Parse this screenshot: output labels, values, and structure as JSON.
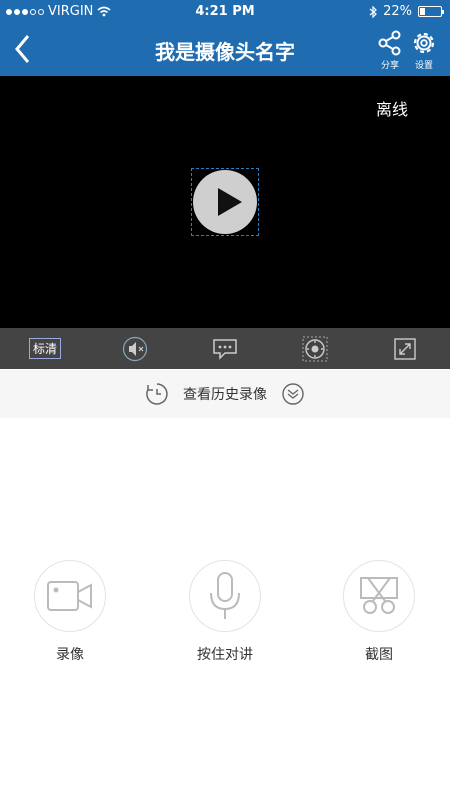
{
  "status_bar": {
    "carrier": "VIRGIN",
    "time": "4:21 PM",
    "battery": "22%",
    "battery_level": 0.22
  },
  "header": {
    "title": "我是摄像头名字",
    "share_label": "分享",
    "settings_label": "设置"
  },
  "video": {
    "status": "离线"
  },
  "toolbar": {
    "quality_label": "标清"
  },
  "history": {
    "label": "查看历史录像"
  },
  "actions": {
    "record_label": "录像",
    "talk_label": "按住对讲",
    "screenshot_label": "截图"
  },
  "colors": {
    "header_bg": "#1f6cb0",
    "toolbar_bg": "#444444",
    "video_bg": "#000000"
  },
  "icons": [
    "back-icon",
    "share-icon",
    "gear-icon",
    "speaker-mute-icon",
    "chat-icon",
    "ptz-icon",
    "fullscreen-icon",
    "clock-icon",
    "chevron-down-icon",
    "video-camera-icon",
    "microphone-icon",
    "scissors-icon"
  ]
}
